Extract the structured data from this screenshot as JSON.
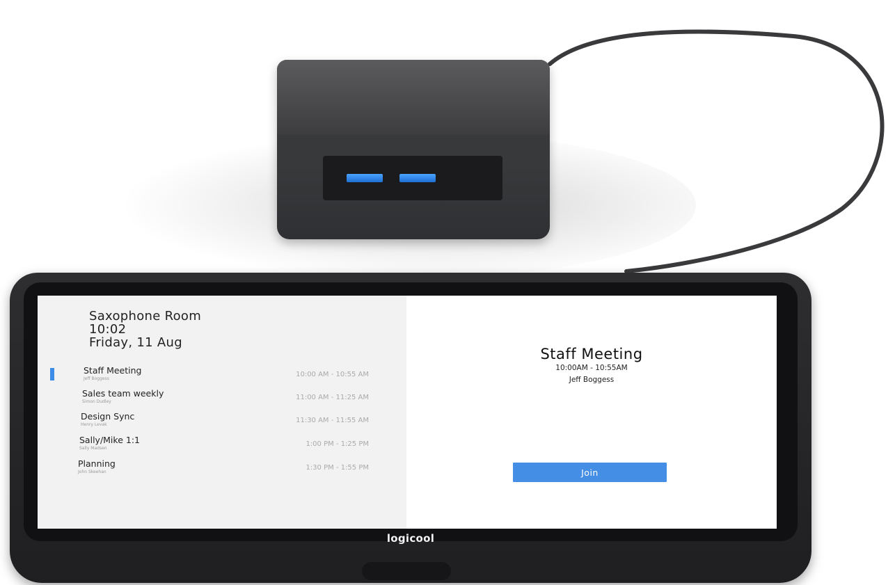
{
  "room": {
    "name": "Saxophone Room",
    "time": "10:02",
    "date": "Friday, 11 Aug"
  },
  "agenda": [
    {
      "title": "Staff Meeting",
      "organizer": "Jeff Boggess",
      "time": "10:00 AM - 10:55 AM",
      "active": true
    },
    {
      "title": "Sales team weekly",
      "organizer": "Simon Dudley",
      "time": "11:00 AM - 11:25 AM",
      "active": false
    },
    {
      "title": "Design Sync",
      "organizer": "Henry Levak",
      "time": "11:30 AM - 11:55 AM",
      "active": false
    },
    {
      "title": "Sally/Mike 1:1",
      "organizer": "Sally Madsen",
      "time": "1:00 PM - 1:25 PM",
      "active": false
    },
    {
      "title": "Planning",
      "organizer": "John Skeehan",
      "time": "1:30 PM - 1:55 PM",
      "active": false
    }
  ],
  "current_meeting": {
    "title": "Staff Meeting",
    "time": "10:00AM - 10:55AM",
    "organizer": "Jeff Boggess",
    "join_label": "Join"
  },
  "device": {
    "brand": "logicool"
  },
  "colors": {
    "accent": "#448ee5",
    "left_pane_bg": "#f2f2f2",
    "usb_port": "#2f86f0",
    "device_body": "#252527"
  },
  "icons": {
    "usb_port": "usb-port-icon"
  }
}
